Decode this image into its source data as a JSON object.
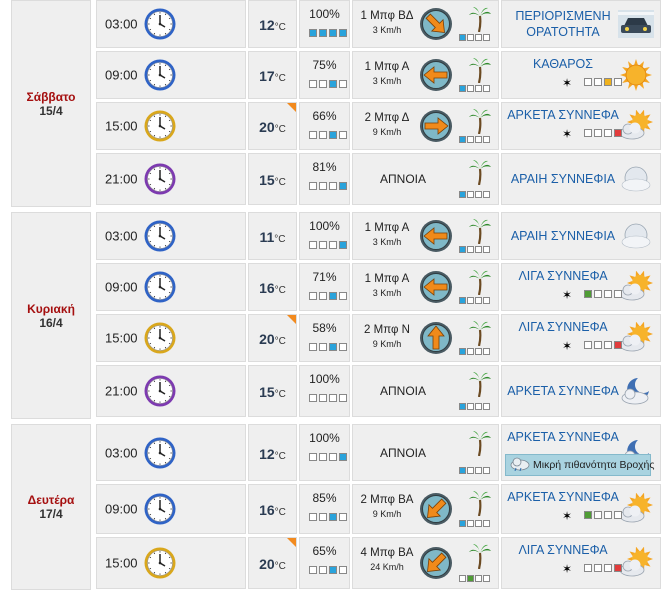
{
  "days": [
    {
      "name": "Σάββατο",
      "date": "15/4",
      "rows": [
        {
          "time": "03:00",
          "clock": "blue",
          "temp": "12",
          "hot": false,
          "hum": "100%",
          "hbar": [
            1,
            1,
            1,
            2
          ],
          "wind": "1 Μπφ ΒΔ",
          "kmh": "3 Km/h",
          "dir": 135,
          "palm": [
            1,
            0,
            0,
            0
          ],
          "palmGreen": false,
          "sky": [
            "ΠΕΡΙΟΡΙΣΜΕΝΗ",
            "ΟΡΑΤΟΤΗΤΑ"
          ],
          "icon": "car",
          "mosq": null
        },
        {
          "time": "09:00",
          "clock": "blue",
          "temp": "17",
          "hot": false,
          "hum": "75%",
          "hbar": [
            0,
            0,
            1,
            0
          ],
          "wind": "1 Μπφ Α",
          "kmh": "3 Km/h",
          "dir": 270,
          "palm": [
            1,
            0,
            0,
            0
          ],
          "palmGreen": false,
          "sky": [
            "ΚΑΘΑΡΟΣ"
          ],
          "icon": "sun",
          "mosq": "sun"
        },
        {
          "time": "15:00",
          "clock": "yellow",
          "temp": "20",
          "hot": true,
          "hum": "66%",
          "hbar": [
            0,
            0,
            1,
            0
          ],
          "wind": "2 Μπφ Δ",
          "kmh": "9 Km/h",
          "dir": 90,
          "palm": [
            1,
            0,
            0,
            0
          ],
          "palmGreen": false,
          "sky": [
            "ΑΡΚΕΤΑ ΣΥΝΝΕΦΑ"
          ],
          "icon": "suncloud",
          "mosq": "red"
        },
        {
          "time": "21:00",
          "clock": "purple",
          "temp": "15",
          "hot": false,
          "hum": "81%",
          "hbar": [
            0,
            0,
            0,
            1
          ],
          "calm": "ΑΠΝΟΙΑ",
          "palm": [
            1,
            0,
            0,
            0
          ],
          "palmGreen": false,
          "sky": [
            "ΑΡΑΙΗ ΣΥΝΝΕΦΙΑ"
          ],
          "icon": "moon",
          "mosq": null
        }
      ]
    },
    {
      "name": "Κυριακή",
      "date": "16/4",
      "rows": [
        {
          "time": "03:00",
          "clock": "blue",
          "temp": "11",
          "hot": false,
          "hum": "100%",
          "hbar": [
            0,
            0,
            0,
            1
          ],
          "wind": "1 Μπφ Α",
          "kmh": "3 Km/h",
          "dir": 270,
          "palm": [
            1,
            0,
            0,
            0
          ],
          "palmGreen": false,
          "sky": [
            "ΑΡΑΙΗ ΣΥΝΝΕΦΙΑ"
          ],
          "icon": "moon",
          "mosq": null
        },
        {
          "time": "09:00",
          "clock": "blue",
          "temp": "16",
          "hot": false,
          "hum": "71%",
          "hbar": [
            0,
            0,
            1,
            0
          ],
          "wind": "1 Μπφ Α",
          "kmh": "3 Km/h",
          "dir": 270,
          "palm": [
            1,
            0,
            0,
            0
          ],
          "palmGreen": false,
          "sky": [
            "ΛΙΓΑ ΣΥΝΝΕΦΑ"
          ],
          "icon": "suncloud",
          "mosq": "green"
        },
        {
          "time": "15:00",
          "clock": "yellow",
          "temp": "20",
          "hot": true,
          "hum": "58%",
          "hbar": [
            0,
            0,
            1,
            0
          ],
          "wind": "2 Μπφ Ν",
          "kmh": "9 Km/h",
          "dir": 0,
          "palm": [
            1,
            0,
            0,
            0
          ],
          "palmGreen": false,
          "sky": [
            "ΛΙΓΑ ΣΥΝΝΕΦΑ"
          ],
          "icon": "suncloud",
          "mosq": "red"
        },
        {
          "time": "21:00",
          "clock": "purple",
          "temp": "15",
          "hot": false,
          "hum": "100%",
          "hbar": [
            0,
            0,
            0,
            0
          ],
          "calm": "ΑΠΝΟΙΑ",
          "palm": [
            1,
            0,
            0,
            0
          ],
          "palmGreen": false,
          "sky": [
            "ΑΡΚΕΤΑ ΣΥΝΝΕΦΑ"
          ],
          "icon": "mooncloud",
          "mosq": null
        }
      ]
    },
    {
      "name": "Δευτέρα",
      "date": "17/4",
      "rows": [
        {
          "time": "03:00",
          "clock": "blue",
          "temp": "12",
          "hot": false,
          "hum": "100%",
          "hbar": [
            0,
            0,
            0,
            1
          ],
          "calm": "ΑΠΝΟΙΑ",
          "palm": [
            1,
            0,
            0,
            0
          ],
          "palmGreen": false,
          "sky": [
            "ΑΡΚΕΤΑ ΣΥΝΝΕΦΑ"
          ],
          "icon": "mooncloud",
          "mosq": null,
          "rain": "Μικρή πιθανότητα Βροχής"
        },
        {
          "time": "09:00",
          "clock": "blue",
          "temp": "16",
          "hot": false,
          "hum": "85%",
          "hbar": [
            0,
            0,
            1,
            0
          ],
          "wind": "2 Μπφ ΒΑ",
          "kmh": "9 Km/h",
          "dir": 225,
          "palm": [
            1,
            0,
            0,
            0
          ],
          "palmGreen": false,
          "sky": [
            "ΑΡΚΕΤΑ ΣΥΝΝΕΦΑ"
          ],
          "icon": "suncloud",
          "mosq": "green"
        },
        {
          "time": "15:00",
          "clock": "yellow",
          "temp": "20",
          "hot": true,
          "hum": "65%",
          "hbar": [
            0,
            0,
            1,
            0
          ],
          "wind": "4 Μπφ ΒΑ",
          "kmh": "24 Km/h",
          "dir": 225,
          "palm": [
            0,
            1,
            0,
            0
          ],
          "palmGreen": true,
          "sky": [
            "ΛΙΓΑ ΣΥΝΝΕΦΑ"
          ],
          "icon": "suncloud",
          "mosq": "red"
        }
      ]
    }
  ],
  "units": {
    "temp": "°C"
  },
  "colors": {
    "day_name": "#a50f0f",
    "sky_text": "#1b5fa8",
    "bar_blue": "#29a3dc",
    "flag": "#f28a1e"
  },
  "icons": {
    "clock": "clock-icon",
    "compass": "wind-compass-icon",
    "palm": "palm-tree-icon",
    "mosquito": "mosquito-icon"
  }
}
